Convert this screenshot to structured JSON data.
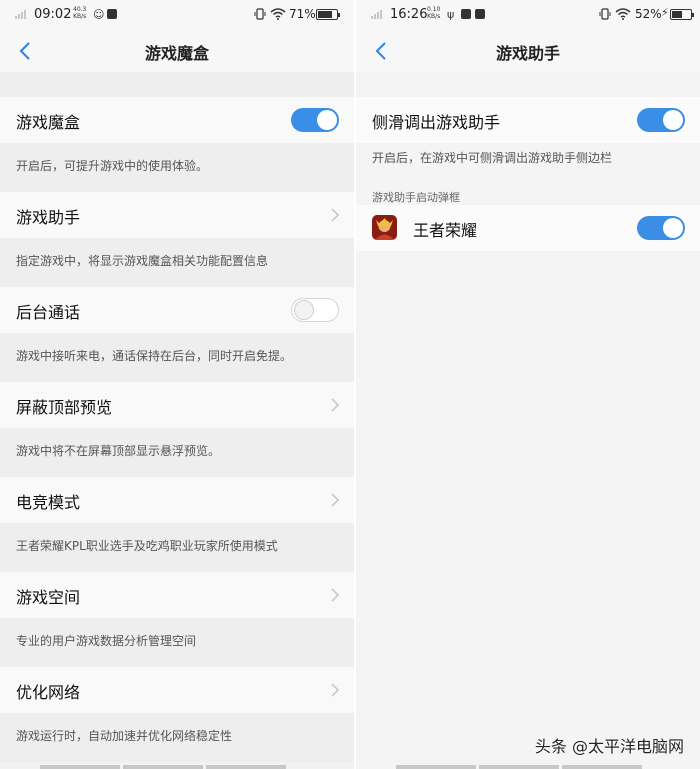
{
  "left": {
    "status": {
      "time": "09:02",
      "speed_top": "40.3",
      "speed_unit": "KB/s",
      "battery": "71%"
    },
    "nav_title": "游戏魔盒",
    "items": [
      {
        "label": "游戏魔盒",
        "type": "toggle",
        "on": true,
        "desc": "开启后，可提升游戏中的使用体验。"
      },
      {
        "label": "游戏助手",
        "type": "link",
        "desc": "指定游戏中，将显示游戏魔盒相关功能配置信息"
      },
      {
        "label": "后台通话",
        "type": "toggle",
        "on": false,
        "desc": "游戏中接听来电，通话保持在后台，同时开启免提。"
      },
      {
        "label": "屏蔽顶部预览",
        "type": "link",
        "desc": "游戏中将不在屏幕顶部显示悬浮预览。"
      },
      {
        "label": "电竞模式",
        "type": "link",
        "desc": "王者荣耀KPL职业选手及吃鸡职业玩家所使用模式"
      },
      {
        "label": "游戏空间",
        "type": "link",
        "desc": "专业的用户游戏数据分析管理空间"
      },
      {
        "label": "优化网络",
        "type": "link",
        "desc": "游戏运行时，自动加速并优化网络稳定性"
      }
    ]
  },
  "right": {
    "status": {
      "time": "16:26",
      "speed_top": "0.10",
      "speed_unit": "KB/s",
      "battery": "52%"
    },
    "nav_title": "游戏助手",
    "toggle_item": {
      "label": "侧滑调出游戏助手",
      "on": true
    },
    "toggle_desc": "开启后，在游戏中可侧滑调出游戏助手侧边栏",
    "section_label": "游戏助手启动弹框",
    "app_item": {
      "label": "王者荣耀",
      "on": true
    }
  },
  "watermark": "头条 @太平洋电脑网",
  "colors": {
    "accent": "#3a8ee6",
    "back": "#2a82e4"
  }
}
